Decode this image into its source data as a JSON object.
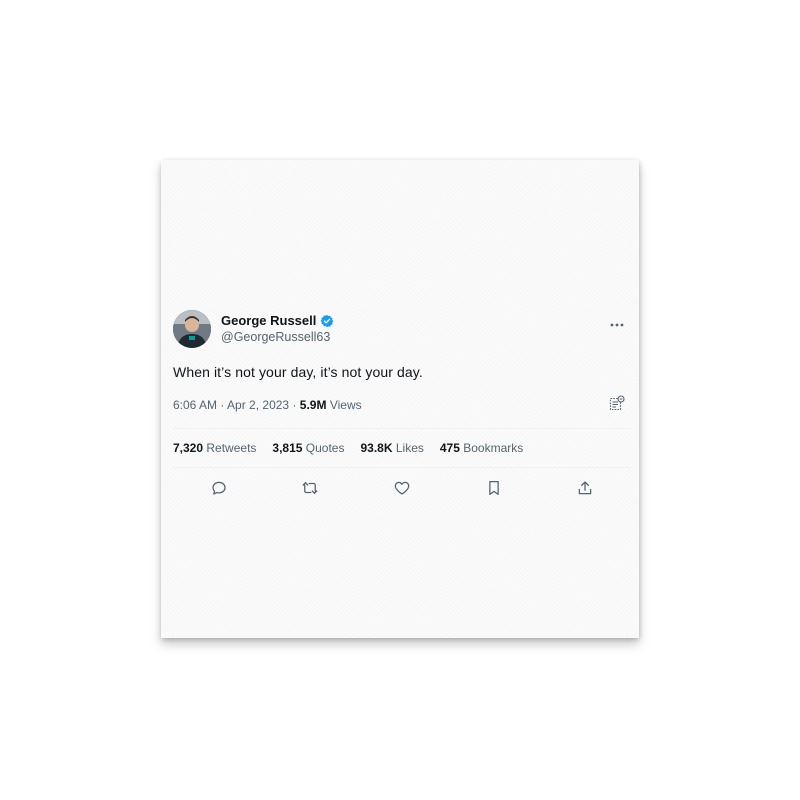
{
  "author": {
    "display_name": "George Russell",
    "handle": "@GeorgeRussell63",
    "verified": true,
    "avatar_icon": "profile-photo"
  },
  "tweet": {
    "text": "When it’s not your day, it’s not your day.",
    "time": "6:06 AM",
    "separator": "·",
    "date": "Apr 2, 2023",
    "views_count": "5.9M",
    "views_label": "Views"
  },
  "stats": {
    "retweets_count": "7,320",
    "retweets_label": "Retweets",
    "quotes_count": "3,815",
    "quotes_label": "Quotes",
    "likes_count": "93.8K",
    "likes_label": "Likes",
    "bookmarks_count": "475",
    "bookmarks_label": "Bookmarks"
  },
  "actions": [
    "reply-icon",
    "retweet-icon",
    "like-icon",
    "bookmark-icon",
    "share-icon"
  ],
  "colors": {
    "verified": "#1d9bf0",
    "text": "#0f1419",
    "secondary": "#536471",
    "divider": "#eff3f4"
  }
}
